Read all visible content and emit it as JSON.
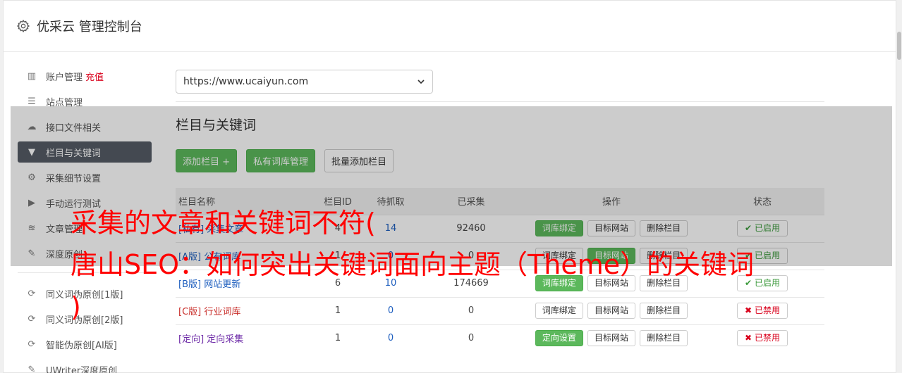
{
  "header": {
    "title": "优采云 管理控制台"
  },
  "sidebar": {
    "items": [
      {
        "label": "账户管理",
        "extra": "充值",
        "icon": "bar-chart-icon"
      },
      {
        "label": "站点管理",
        "icon": "server-icon"
      },
      {
        "label": "接口文件相关",
        "icon": "cloud-upload-icon"
      },
      {
        "label": "栏目与关键词",
        "icon": "filter-icon",
        "active": true
      },
      {
        "label": "采集细节设置",
        "icon": "gears-icon"
      },
      {
        "label": "手动运行测试",
        "icon": "play-circle-icon"
      },
      {
        "label": "文章管理",
        "icon": "database-icon"
      },
      {
        "label": "深度原创",
        "icon": "edit-icon"
      }
    ],
    "items2": [
      {
        "label": "同义词伪原创[1版]",
        "icon": "refresh-icon"
      },
      {
        "label": "同义词伪原创[2版]",
        "icon": "refresh-icon"
      },
      {
        "label": "智能伪原创[AI版]",
        "icon": "refresh-icon"
      },
      {
        "label": "UWriter深度原创",
        "icon": "edit-icon"
      }
    ]
  },
  "main": {
    "site_select": "https://www.ucaiyun.com",
    "section_title": "栏目与关键词",
    "buttons": {
      "add": "添加栏目 +",
      "private": "私有词库管理",
      "batch": "批量添加栏目"
    },
    "table": {
      "headers": [
        "栏目名称",
        "栏目ID",
        "待抓取",
        "已采集",
        "操作",
        "状态"
      ],
      "rows": [
        {
          "tag": "[私有]",
          "name": "采集文章",
          "id": "4",
          "pending": "14",
          "done": "92460",
          "op1": "词库绑定",
          "op1_green": true,
          "op2": "目标网站",
          "op2_green": false,
          "op3": "删除栏目",
          "status": "已启用",
          "on": true
        },
        {
          "tag": "[A版]",
          "name": "公有词库",
          "id": "1",
          "pending": "0",
          "done": "0",
          "op1": "词库绑定",
          "op1_green": false,
          "op2": "目标网站",
          "op2_green": true,
          "op3": "删除栏目",
          "status": "已启用",
          "on": true
        },
        {
          "tag": "[B版]",
          "name": "网站更新",
          "id": "6",
          "pending": "10",
          "done": "174669",
          "op1": "词库绑定",
          "op1_green": true,
          "op2": "目标网站",
          "op2_green": false,
          "op3": "删除栏目",
          "status": "已启用",
          "on": true
        },
        {
          "tag": "[C版]",
          "name": "行业词库",
          "id": "1",
          "pending": "0",
          "done": "0",
          "op1": "词库绑定",
          "op1_green": false,
          "op2": "目标网站",
          "op2_green": false,
          "op3": "删除栏目",
          "status": "已禁用",
          "on": false
        },
        {
          "tag": "[定向]",
          "name": "定向采集",
          "id": "1",
          "pending": "0",
          "done": "0",
          "op1": "定向设置",
          "op1_green": true,
          "op2": "目标网站",
          "op2_green": false,
          "op3": "删除栏目",
          "status": "已禁用",
          "on": false
        }
      ]
    }
  },
  "overlay_text": {
    "line1": "采集的文章和关键词不符(",
    "line2": "唐山SEO：如何突出关键词面向主题（Theme）的关键词",
    "line3": ")"
  },
  "colors": {
    "green": "#5cb85c",
    "active_nav": "#555c66",
    "red": "#ff0000"
  }
}
